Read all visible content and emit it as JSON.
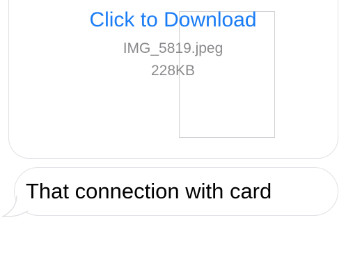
{
  "attachment": {
    "download_label": "Click to Download",
    "file_name": "IMG_5819.jpeg",
    "file_size": "228KB"
  },
  "message": {
    "text": "That connection with card",
    "direction": "incoming"
  },
  "colors": {
    "link": "#1a7cf5",
    "secondary_text": "#8a8a8e",
    "bubble_border": "#e1e1e6",
    "background": "#ffffff"
  }
}
